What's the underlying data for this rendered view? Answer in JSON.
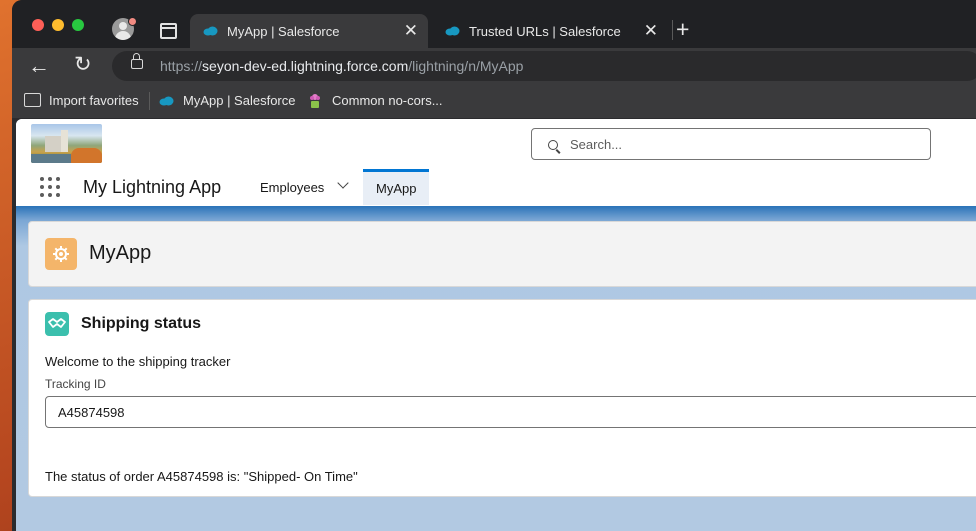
{
  "browser": {
    "tabs": [
      {
        "title": "MyApp | Salesforce",
        "close": "✕",
        "active": true
      },
      {
        "title": "Trusted URLs | Salesforce",
        "close": "✕",
        "active": false
      }
    ],
    "new_tab": "+",
    "url_prefix": "https://",
    "url_host": "seyon-dev-ed.lightning.force.com",
    "url_path": "/lightning/n/MyApp",
    "bookmarks": [
      {
        "label": "Import favorites"
      },
      {
        "label": "MyApp | Salesforce"
      },
      {
        "label": "Common no-cors..."
      }
    ]
  },
  "salesforce": {
    "search_placeholder": "Search...",
    "app_name": "My Lightning App",
    "nav": [
      {
        "label": "Employees"
      },
      {
        "label": "MyApp",
        "active": true
      }
    ]
  },
  "page": {
    "title": "MyApp"
  },
  "card": {
    "title": "Shipping status",
    "welcome": "Welcome to the shipping tracker",
    "tracking_label": "Tracking ID",
    "tracking_value": "A45874598",
    "status_message": "The status of order A45874598 is: \"Shipped- On Time\""
  },
  "colors": {
    "accent": "#0176d3",
    "app_icon": "#f4b56a",
    "card_icon": "#3bbfad",
    "salesforce_cloud": "#1798c1"
  },
  "icons": [
    "close-icon",
    "plus-icon",
    "back-arrow-icon",
    "reload-icon",
    "lock-icon",
    "folder-icon",
    "salesforce-cloud-icon",
    "plant-icon",
    "search-icon",
    "app-launcher-icon",
    "chevron-down-icon",
    "gear-icon",
    "handshake-icon"
  ]
}
